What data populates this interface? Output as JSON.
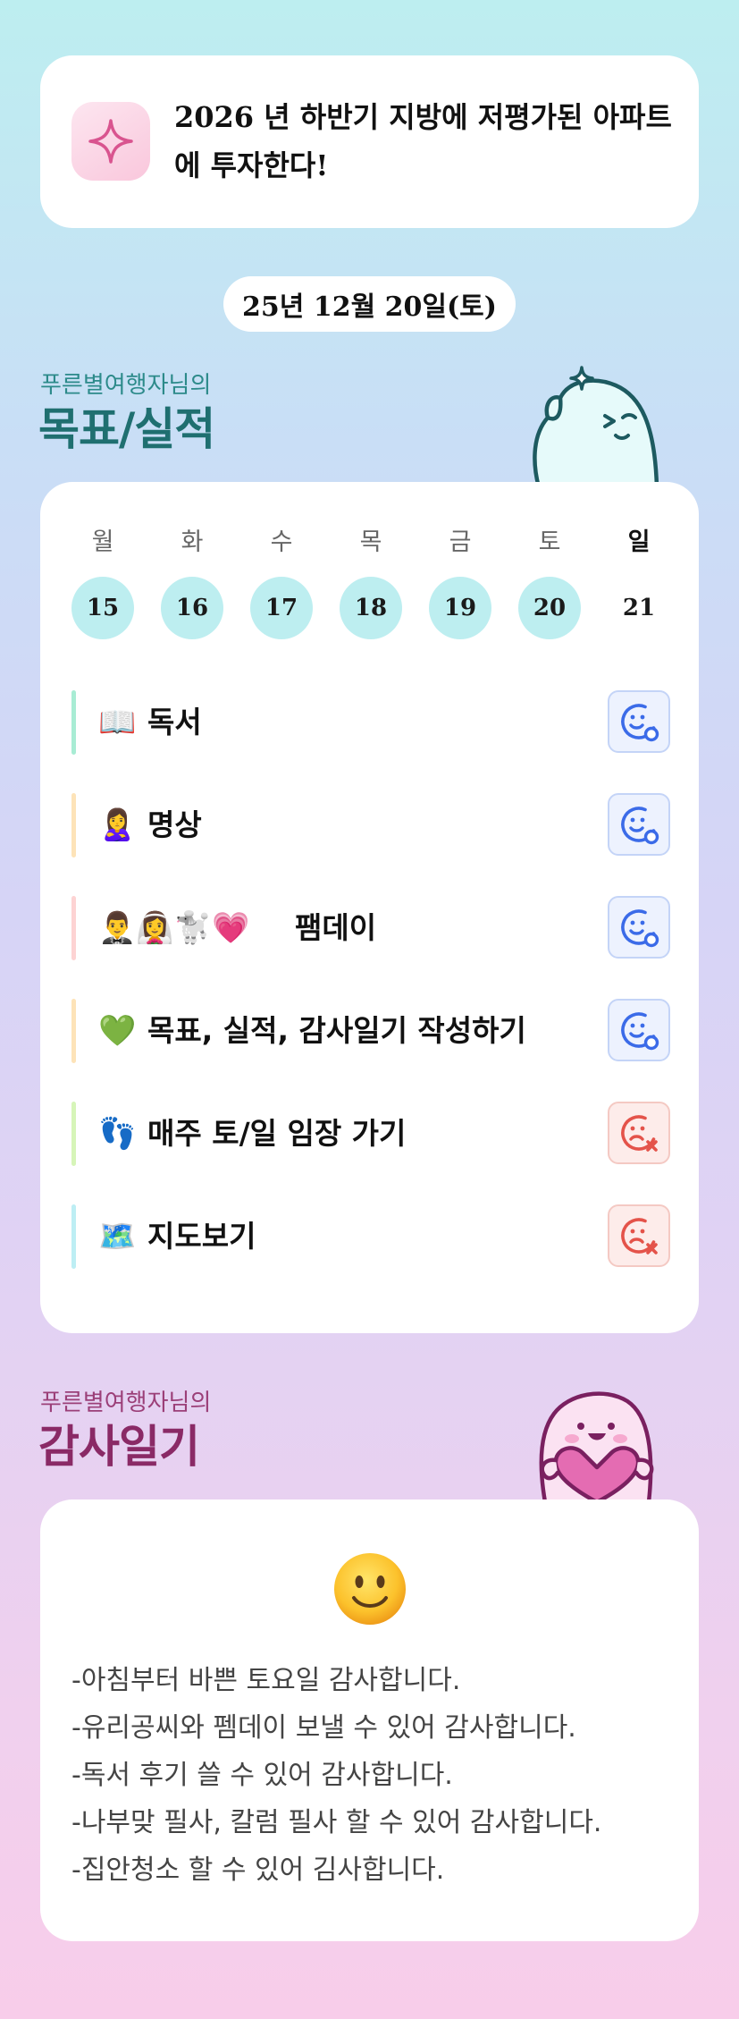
{
  "goal": {
    "icon": "sparkle-icon",
    "line1": "2026 년 하반기 지방에 저평가된 아파트",
    "line2": "에 투자한다!"
  },
  "date": "25년 12월 20일(토)",
  "goals_section": {
    "subtitle": "푸른별여행자님의",
    "title": "목표/실적"
  },
  "week": {
    "days": [
      {
        "label": "월",
        "num": "15",
        "highlight": true
      },
      {
        "label": "화",
        "num": "16",
        "highlight": true
      },
      {
        "label": "수",
        "num": "17",
        "highlight": true
      },
      {
        "label": "목",
        "num": "18",
        "highlight": true
      },
      {
        "label": "금",
        "num": "19",
        "highlight": true
      },
      {
        "label": "토",
        "num": "20",
        "highlight": true
      },
      {
        "label": "일",
        "num": "21",
        "highlight": false
      }
    ]
  },
  "tasks": [
    {
      "emoji": "📖",
      "name": "독서",
      "bar_color": "#a8ecd4",
      "status": "done"
    },
    {
      "emoji": "🙎‍♀️",
      "name": "명상",
      "bar_color": "#fde3b8",
      "status": "done"
    },
    {
      "emoji": "🤵‍♂️👰‍♀️🐩💗",
      "name": "팸데이",
      "bar_color": "#fdd3d3",
      "status": "done"
    },
    {
      "emoji": "💚",
      "name": "목표, 실적, 감사일기 작성하기",
      "bar_color": "#fde3b8",
      "status": "done"
    },
    {
      "emoji": "👣",
      "name": "매주 토/일 임장 가기",
      "bar_color": "#d6f5b8",
      "status": "missed"
    },
    {
      "emoji": "🗺️",
      "name": "지도보기",
      "bar_color": "#bdeef4",
      "status": "missed"
    }
  ],
  "gratitude_section": {
    "subtitle": "푸른별여행자님의",
    "title": "감사일기",
    "mood_icon": "smiley-face-icon",
    "lines": [
      "-아침부터 바쁜 토요일 감사합니다.",
      "-유리공씨와 펨데이 보낼 수 있어 감사합니다.",
      "-독서 후기 쓸 수 있어 감사합니다.",
      "-나부맞 필사, 칼럼 필사 할 수 있어 감사합니다.",
      "-집안청소 할 수 있어 김사합니다."
    ]
  },
  "colors": {
    "teal_title": "#1f6f70",
    "plum_title": "#8a2a66",
    "done_icon": "#3b6be8",
    "missed_icon": "#e4534a",
    "day_highlight": "#bdeef0"
  }
}
